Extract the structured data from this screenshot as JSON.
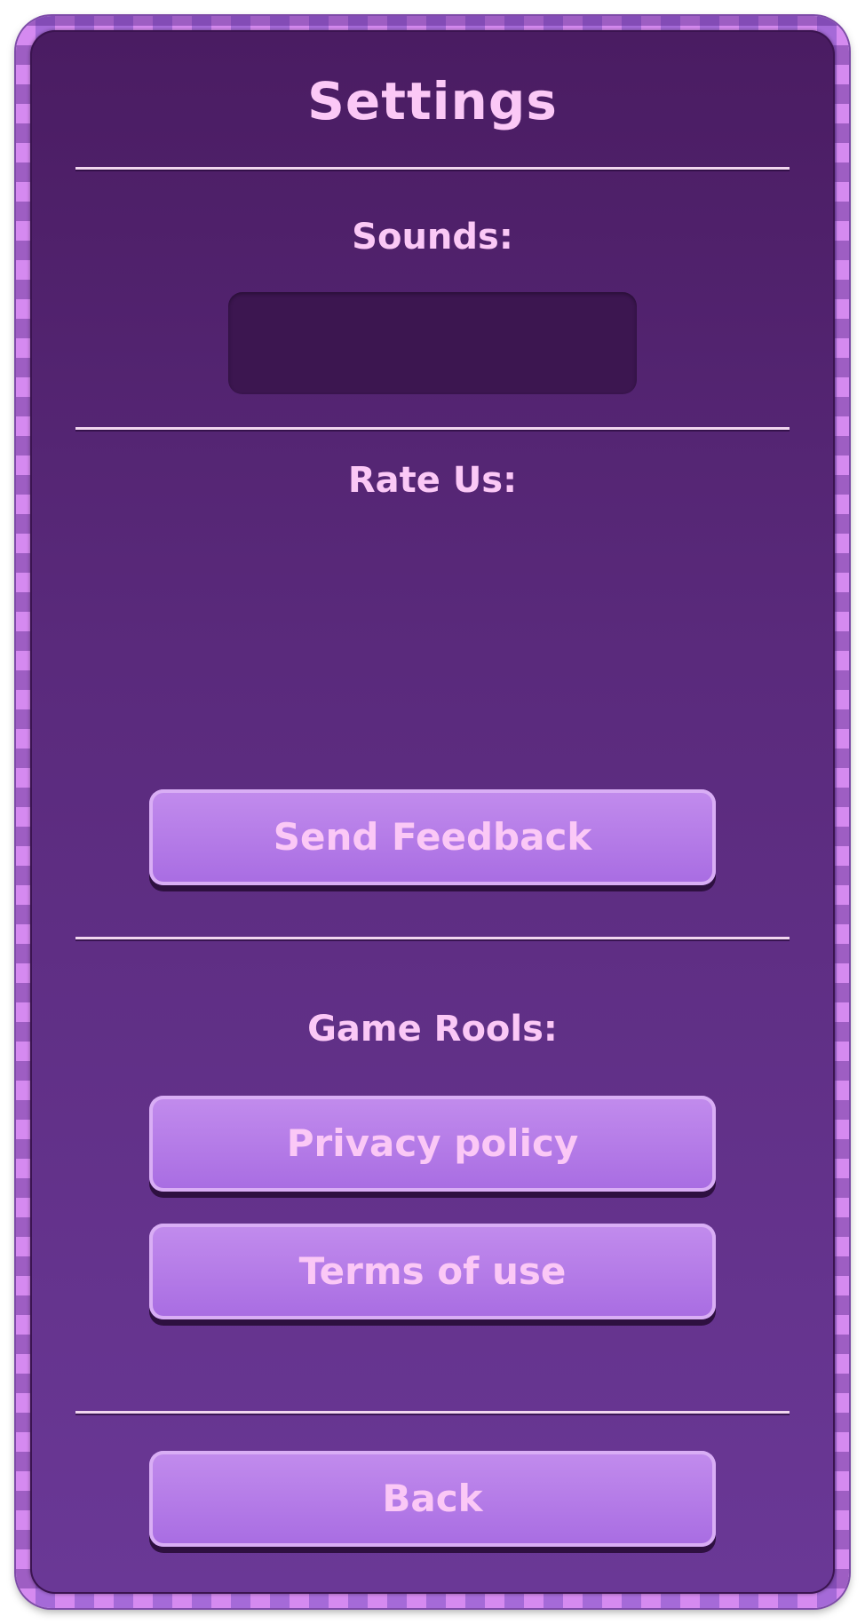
{
  "title": "Settings",
  "sections": {
    "sounds": {
      "label": "Sounds:"
    },
    "rate": {
      "label": "Rate Us:"
    },
    "rules": {
      "label": "Game Rools:"
    }
  },
  "buttons": {
    "send_feedback": "Send Feedback",
    "privacy_policy": "Privacy policy",
    "terms_of_use": "Terms of use",
    "back": "Back"
  },
  "colors": {
    "panel_top": "#4a1c62",
    "panel_bottom": "#6a3896",
    "text": "#fbc8f6",
    "button": "#a86ce2",
    "frame_stripe": "#d58af0"
  }
}
